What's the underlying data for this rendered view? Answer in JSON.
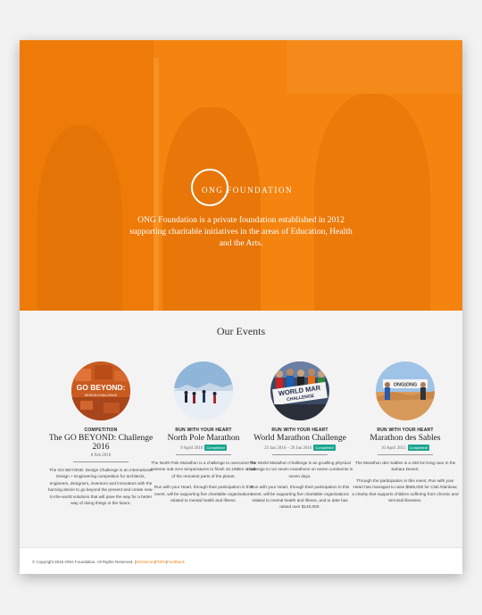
{
  "hero": {
    "logo_text": "ONG FOUNDATION",
    "description": "ONG Foundation is a private foundation established in 2012 supporting charitable initiatives in the areas of Education, Health and the Arts.",
    "color": "#f4840f"
  },
  "events": {
    "heading": "Our Events",
    "items": [
      {
        "category": "COMPETITION",
        "title": "The GO BEYOND: Challenge 2016",
        "date": "8 Feb 2016",
        "badge": "",
        "image_text": "GO BEYOND:",
        "image_subtext": "DESIGN CHALLENGE",
        "desc": [
          "The GO BEYOND: Design Challenge is an international Design + Engineering competition for architects, engineers, designers, inventors and innovators with the burning desire to go beyond the present and create new-to-the-world solutions that will pave the way for a better way of doing things in the future."
        ]
      },
      {
        "category": "RUN WITH YOUR HEART",
        "title": "North Pole Marathon",
        "date": "9 April 2016",
        "badge": "Completed!",
        "image_text": "",
        "image_subtext": "",
        "desc": [
          "The North Pole Marathon is a challenge to overcome the extreme sub-zero temperatures to finish 42.195km in one of the remotest parts of the planet.",
          "Run with your Heart, through their participation in this event, will be supporting five charitable organisations related to mental health and illness."
        ]
      },
      {
        "category": "RUN WITH YOUR HEART",
        "title": "World Marathon Challenge",
        "date": "23 Jan 2016 – 29 Jan 2016",
        "badge": "Completed!",
        "image_text": "WORLD MAR",
        "image_subtext": "CHALLENGE",
        "desc": [
          "The World Marathon Challenge is an gruelling physical challenge to run seven marathons on seven continents in seven days.",
          "Run with your Heart, through their participation in this event, will be supporting five charitable organisations related to mental health and illness, and to date has raised over $140,000."
        ]
      },
      {
        "category": "RUN WITH YOUR HEART",
        "title": "Marathon des Sables",
        "date": "10 April 2015",
        "badge": "Completed!",
        "image_text": "ONG|ONG",
        "image_subtext": "",
        "desc": [
          "The Marathon des Sables is a 250 km-long race in the Sahara Desert.",
          "Through the participation in this event, Run with your Heart has managed to raise $586,000 for Club Rainbow, a charity that supports children suffering from chronic and terminal illnesses."
        ]
      }
    ]
  },
  "footer": {
    "copyright": "© Copyright 2016 ONG Foundation. All Rights Reserved.",
    "sep1": "|",
    "disclaimer": "Disclaimer",
    "sep2": "|",
    "pdpa": "PDPA",
    "sep3": "|",
    "feedback": "Feedback"
  }
}
